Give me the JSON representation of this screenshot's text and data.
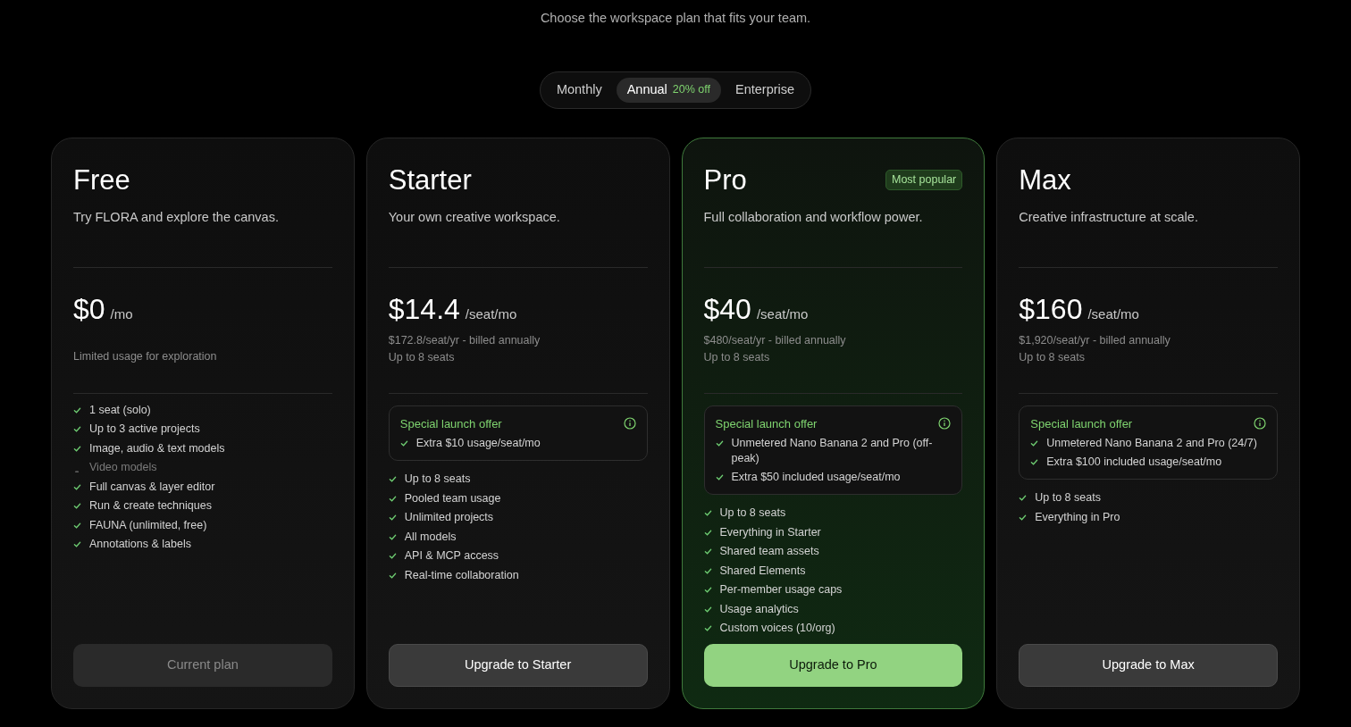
{
  "subtitle": "Choose the workspace plan that fits your team.",
  "billing_tabs": [
    {
      "label": "Monthly",
      "selected": false
    },
    {
      "label": "Annual",
      "selected": true,
      "badge": "20% off"
    },
    {
      "label": "Enterprise",
      "selected": false
    }
  ],
  "plans": [
    {
      "name": "Free",
      "description": "Try FLORA and explore the canvas.",
      "highlighted": false,
      "price": "$0",
      "unit": "/mo",
      "notes": [
        "Limited usage for exploration"
      ],
      "features": [
        {
          "text": "1 seat (solo)",
          "included": true
        },
        {
          "text": "Up to 3 active projects",
          "included": true
        },
        {
          "text": "Image, audio & text models",
          "included": true
        },
        {
          "text": "Video models",
          "included": false
        },
        {
          "text": "Full canvas & layer editor",
          "included": true
        },
        {
          "text": "Run & create techniques",
          "included": true
        },
        {
          "text": "FAUNA (unlimited, free)",
          "included": true
        },
        {
          "text": "Annotations & labels",
          "included": true
        }
      ],
      "button": {
        "label": "Current plan",
        "kind": "current"
      }
    },
    {
      "name": "Starter",
      "description": "Your own creative workspace.",
      "highlighted": false,
      "price": "$14.4",
      "unit": "/seat/mo",
      "notes": [
        "$172.8/seat/yr - billed annually",
        "Up to 8 seats"
      ],
      "offer": {
        "title": "Special launch offer",
        "items": [
          "Extra $10 usage/seat/mo"
        ]
      },
      "features": [
        {
          "text": "Up to 8 seats",
          "included": true
        },
        {
          "text": "Pooled team usage",
          "included": true
        },
        {
          "text": "Unlimited projects",
          "included": true
        },
        {
          "text": "All models",
          "included": true
        },
        {
          "text": "API & MCP access",
          "included": true
        },
        {
          "text": "Real-time collaboration",
          "included": true
        }
      ],
      "button": {
        "label": "Upgrade to Starter",
        "kind": "secondary"
      }
    },
    {
      "name": "Pro",
      "badge": "Most popular",
      "description": "Full collaboration and workflow power.",
      "highlighted": true,
      "price": "$40",
      "unit": "/seat/mo",
      "notes": [
        "$480/seat/yr - billed annually",
        "Up to 8 seats"
      ],
      "offer": {
        "title": "Special launch offer",
        "items": [
          "Unmetered Nano Banana 2 and Pro (off-peak)",
          "Extra $50 included usage/seat/mo"
        ]
      },
      "features": [
        {
          "text": "Up to 8 seats",
          "included": true
        },
        {
          "text": "Everything in Starter",
          "included": true
        },
        {
          "text": "Shared team assets",
          "included": true
        },
        {
          "text": "Shared Elements",
          "included": true
        },
        {
          "text": "Per-member usage caps",
          "included": true
        },
        {
          "text": "Usage analytics",
          "included": true
        },
        {
          "text": "Custom voices (10/org)",
          "included": true
        }
      ],
      "button": {
        "label": "Upgrade to Pro",
        "kind": "primary"
      }
    },
    {
      "name": "Max",
      "description": "Creative infrastructure at scale.",
      "highlighted": false,
      "price": "$160",
      "unit": "/seat/mo",
      "notes": [
        "$1,920/seat/yr - billed annually",
        "Up to 8 seats"
      ],
      "offer": {
        "title": "Special launch offer",
        "items": [
          "Unmetered Nano Banana 2 and Pro (24/7)",
          "Extra $100 included usage/seat/mo"
        ]
      },
      "features": [
        {
          "text": "Up to 8 seats",
          "included": true
        },
        {
          "text": "Everything in Pro",
          "included": true
        }
      ],
      "button": {
        "label": "Upgrade to Max",
        "kind": "secondary"
      }
    }
  ]
}
